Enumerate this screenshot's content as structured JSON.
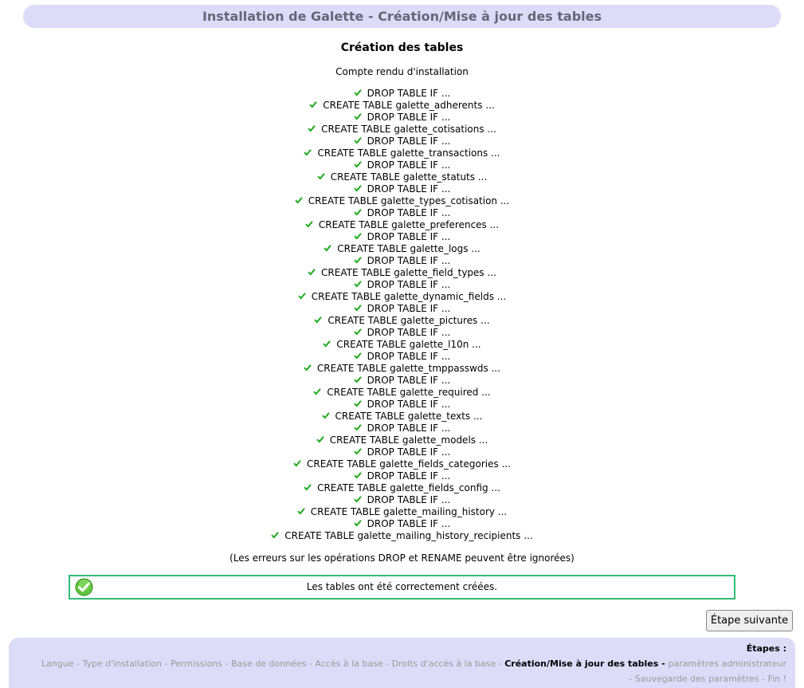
{
  "header": {
    "title": "Installation de Galette - Création/Mise à jour des tables"
  },
  "main": {
    "section_title": "Création des tables",
    "report_label": "Compte rendu d'installation",
    "log": [
      "DROP TABLE IF ...",
      "CREATE TABLE galette_adherents ...",
      "DROP TABLE IF ...",
      "CREATE TABLE galette_cotisations ...",
      "DROP TABLE IF ...",
      "CREATE TABLE galette_transactions ...",
      "DROP TABLE IF ...",
      "CREATE TABLE galette_statuts ...",
      "DROP TABLE IF ...",
      "CREATE TABLE galette_types_cotisation ...",
      "DROP TABLE IF ...",
      "CREATE TABLE galette_preferences ...",
      "DROP TABLE IF ...",
      "CREATE TABLE galette_logs ...",
      "DROP TABLE IF ...",
      "CREATE TABLE galette_field_types ...",
      "DROP TABLE IF ...",
      "CREATE TABLE galette_dynamic_fields ...",
      "DROP TABLE IF ...",
      "CREATE TABLE galette_pictures ...",
      "DROP TABLE IF ...",
      "CREATE TABLE galette_l10n ...",
      "DROP TABLE IF ...",
      "CREATE TABLE galette_tmppasswds ...",
      "DROP TABLE IF ...",
      "CREATE TABLE galette_required ...",
      "DROP TABLE IF ...",
      "CREATE TABLE galette_texts ...",
      "DROP TABLE IF ...",
      "CREATE TABLE galette_models ...",
      "DROP TABLE IF ...",
      "CREATE TABLE galette_fields_categories ...",
      "DROP TABLE IF ...",
      "CREATE TABLE galette_fields_config ...",
      "DROP TABLE IF ...",
      "CREATE TABLE galette_mailing_history ...",
      "DROP TABLE IF ...",
      "CREATE TABLE galette_mailing_history_recipients ..."
    ],
    "note": "(Les erreurs sur les opérations DROP et RENAME peuvent être ignorées)",
    "success_message": "Les tables ont été correctement créées.",
    "next_button": "Étape suivante"
  },
  "footer": {
    "steps_title": "Étapes :",
    "steps": [
      "Langue",
      "Type d'installation",
      "Permissions",
      "Base de données",
      "Accès à la base",
      "Droits d'accès à la base",
      "Création/Mise à jour des tables",
      "paramètres administrateur",
      "Sauvegarde des paramètres",
      "Fin !"
    ],
    "current_step_index": 6
  },
  "colors": {
    "header_bg": "#dcdcf8",
    "check_green": "#22aa22",
    "success_border": "#33bb77"
  },
  "icons": {
    "log_status": "check-icon",
    "success": "success-check-icon"
  }
}
